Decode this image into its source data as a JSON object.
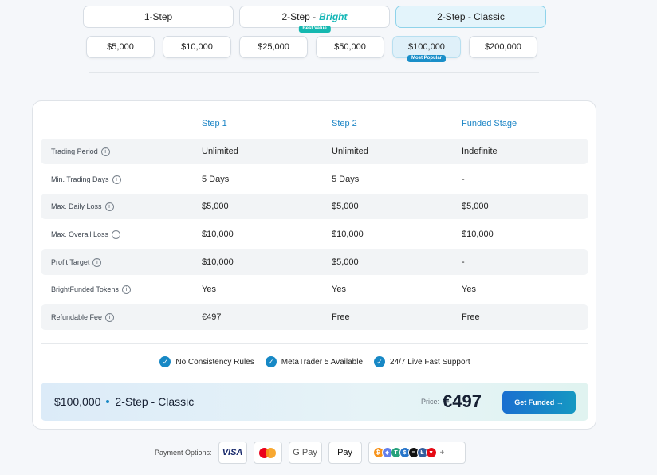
{
  "plans": [
    {
      "label": "1-Step",
      "accent": ""
    },
    {
      "label": "2-Step -",
      "accent": "Bright",
      "badge": "Best Value"
    },
    {
      "label": "2-Step - Classic",
      "accent": ""
    }
  ],
  "sizes": [
    {
      "label": "$5,000"
    },
    {
      "label": "$10,000"
    },
    {
      "label": "$25,000"
    },
    {
      "label": "$50,000"
    },
    {
      "label": "$100,000",
      "badge": "Most Popular"
    },
    {
      "label": "$200,000"
    }
  ],
  "table": {
    "columns": [
      "Step 1",
      "Step 2",
      "Funded Stage"
    ],
    "rows": [
      {
        "label": "Trading Period",
        "values": [
          "Unlimited",
          "Unlimited",
          "Indefinite"
        ]
      },
      {
        "label": "Min. Trading Days",
        "values": [
          "5 Days",
          "5 Days",
          "-"
        ]
      },
      {
        "label": "Max. Daily Loss",
        "values": [
          "$5,000",
          "$5,000",
          "$5,000"
        ]
      },
      {
        "label": "Max. Overall Loss",
        "values": [
          "$10,000",
          "$10,000",
          "$10,000"
        ]
      },
      {
        "label": "Profit Target",
        "values": [
          "$10,000",
          "$5,000",
          "-"
        ]
      },
      {
        "label": "BrightFunded Tokens",
        "values": [
          "Yes",
          "Yes",
          "Yes"
        ]
      },
      {
        "label": "Refundable Fee",
        "values": [
          "€497",
          "Free",
          "Free"
        ]
      }
    ]
  },
  "features": [
    "No Consistency Rules",
    "MetaTrader 5 Available",
    "24/7 Live Fast Support"
  ],
  "summary": {
    "size": "$100,000",
    "plan": "2-Step - Classic",
    "price_label": "Price:",
    "price": "€497",
    "cta": "Get Funded →"
  },
  "payment": {
    "label": "Payment Options:",
    "visa": "VISA",
    "gpay": "G Pay",
    "apay": " Pay",
    "crypto_more": "+"
  },
  "colors": {
    "accent_blue": "#1a84c5",
    "accent_teal": "#13b6b6",
    "active_tab_bg": "#e3f4fb"
  }
}
